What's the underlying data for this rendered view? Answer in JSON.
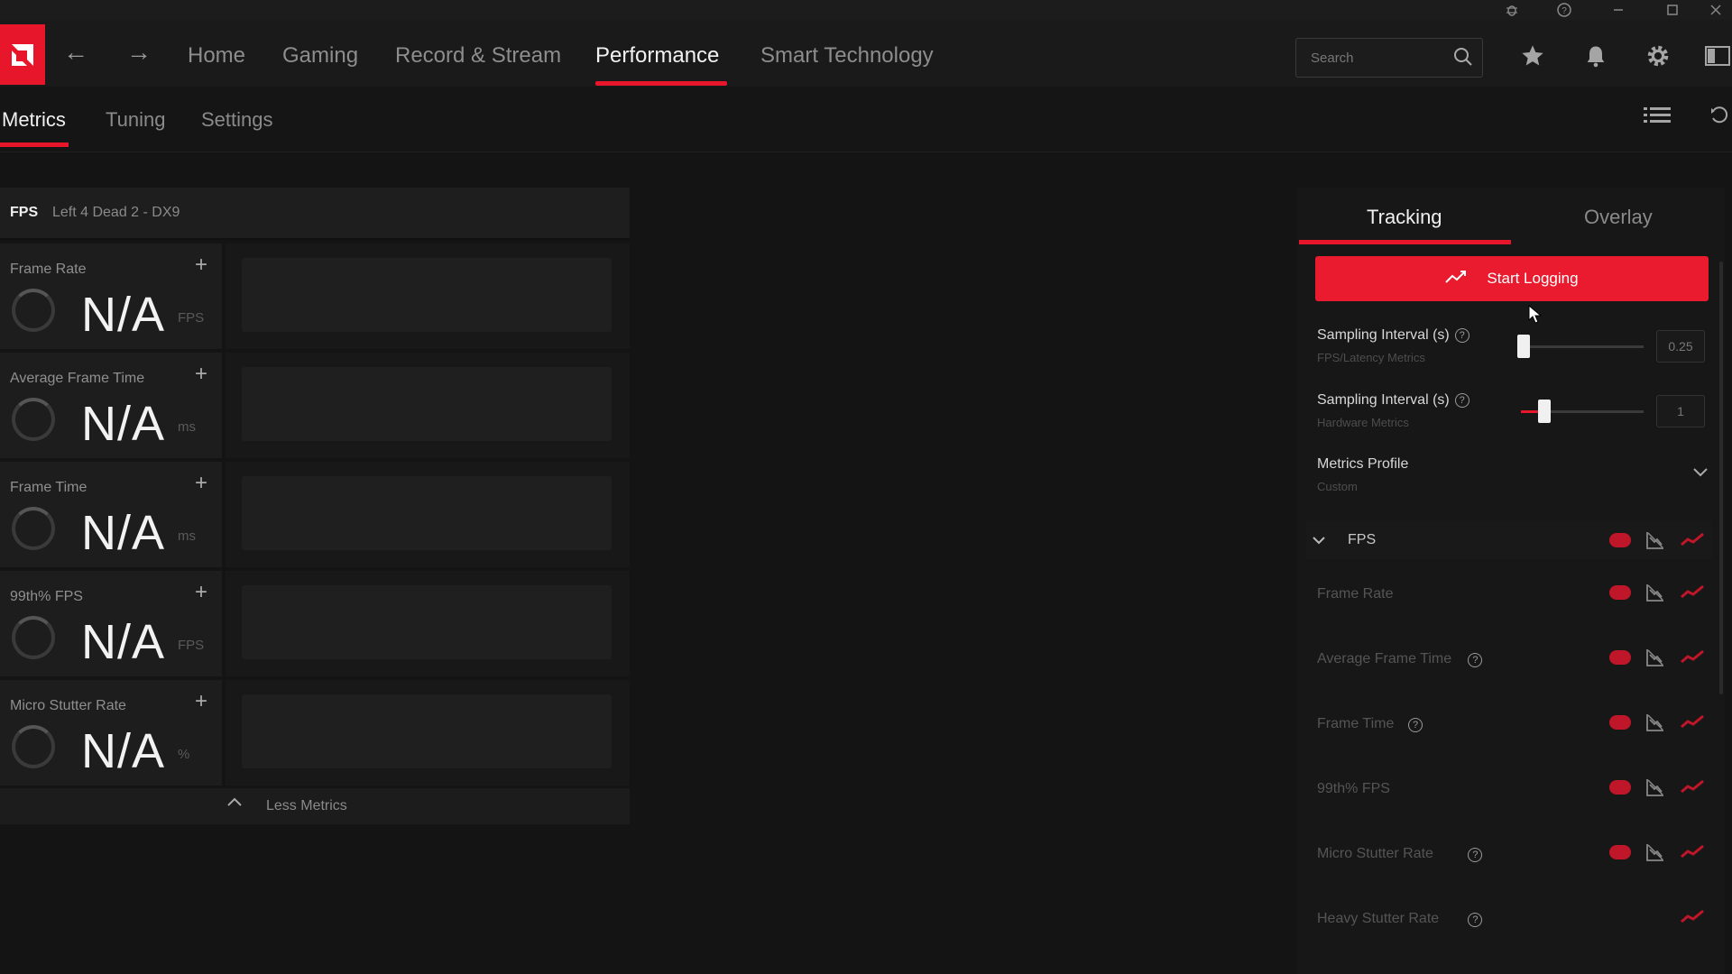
{
  "colors": {
    "accent": "#e8162a",
    "background": "#141414",
    "panel": "#1d1d1d"
  },
  "window_controls": [
    "bug-icon",
    "help-icon",
    "minimize-icon",
    "maximize-icon",
    "close-icon"
  ],
  "nav": {
    "links": [
      "Home",
      "Gaming",
      "Record & Stream",
      "Performance",
      "Smart Technology"
    ],
    "active": "Performance"
  },
  "search": {
    "placeholder": "Search"
  },
  "subnav": {
    "tabs": [
      "Metrics",
      "Tuning",
      "Settings"
    ],
    "active": "Metrics"
  },
  "metrics_panel": {
    "header_tag": "FPS",
    "game": "Left 4 Dead 2 - DX9",
    "items": [
      {
        "title": "Frame Rate",
        "value": "N/A",
        "unit": "FPS"
      },
      {
        "title": "Average Frame Time",
        "value": "N/A",
        "unit": "ms"
      },
      {
        "title": "Frame Time",
        "value": "N/A",
        "unit": "ms"
      },
      {
        "title": "99th% FPS",
        "value": "N/A",
        "unit": "FPS"
      },
      {
        "title": "Micro Stutter Rate",
        "value": "N/A",
        "unit": "%"
      }
    ],
    "less_label": "Less Metrics"
  },
  "side_panel": {
    "tabs": [
      "Tracking",
      "Overlay"
    ],
    "active_tab": "Tracking",
    "start_button": "Start Logging",
    "sampling1": {
      "label": "Sampling Interval (s)",
      "sub": "FPS/Latency Metrics",
      "value": "0.25",
      "level": 0.0
    },
    "sampling2": {
      "label": "Sampling Interval (s)",
      "sub": "Hardware Metrics",
      "value": "1",
      "level": 0.17
    },
    "profile": {
      "label": "Metrics Profile",
      "value": "Custom"
    },
    "group": "FPS",
    "rows": [
      {
        "label": "Frame Rate",
        "help": false
      },
      {
        "label": "Average Frame Time",
        "help": true
      },
      {
        "label": "Frame Time",
        "help": true
      },
      {
        "label": "99th% FPS",
        "help": false
      },
      {
        "label": "Micro Stutter Rate",
        "help": true
      },
      {
        "label": "Heavy Stutter Rate",
        "help": true
      }
    ]
  }
}
